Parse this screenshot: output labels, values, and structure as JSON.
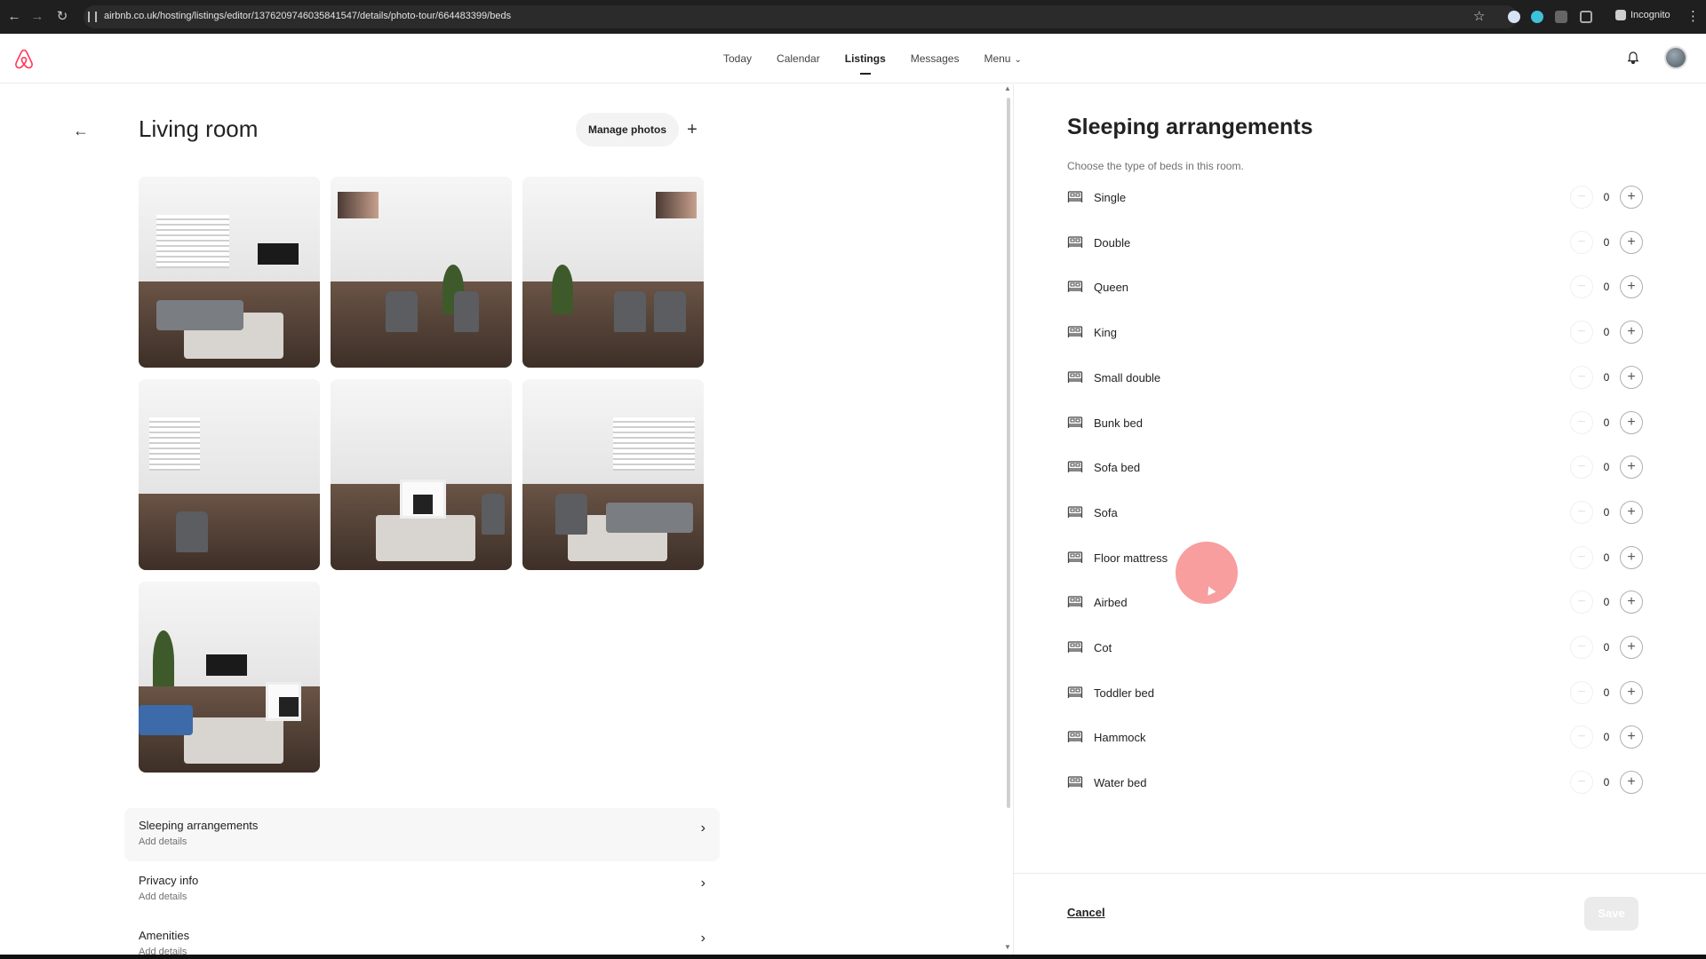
{
  "browser": {
    "url": "airbnb.co.uk/hosting/listings/editor/1376209746035841547/details/photo-tour/664483399/beds",
    "mode_label": "Incognito"
  },
  "nav": {
    "items": [
      {
        "label": "Today",
        "active": false
      },
      {
        "label": "Calendar",
        "active": false
      },
      {
        "label": "Listings",
        "active": true
      },
      {
        "label": "Messages",
        "active": false
      },
      {
        "label": "Menu",
        "active": false
      }
    ]
  },
  "room": {
    "title": "Living room",
    "manage_photos_label": "Manage photos",
    "add_label": "+",
    "photos": [
      {
        "scene": "sofa-tv"
      },
      {
        "scene": "chairs-plant"
      },
      {
        "scene": "dining-picture"
      },
      {
        "scene": "hallway-desk"
      },
      {
        "scene": "fireplace"
      },
      {
        "scene": "sofa-window"
      },
      {
        "scene": "tv-fireplace"
      }
    ],
    "sections": [
      {
        "title": "Sleeping arrangements",
        "subtitle": "Add details"
      },
      {
        "title": "Privacy info",
        "subtitle": "Add details"
      },
      {
        "title": "Amenities",
        "subtitle": "Add details"
      }
    ]
  },
  "sleeping": {
    "title": "Sleeping arrangements",
    "subtitle": "Choose the type of beds in this room.",
    "minus_label": "−",
    "plus_label": "+",
    "beds": [
      {
        "label": "Single",
        "count": "0"
      },
      {
        "label": "Double",
        "count": "0"
      },
      {
        "label": "Queen",
        "count": "0"
      },
      {
        "label": "King",
        "count": "0"
      },
      {
        "label": "Small double",
        "count": "0"
      },
      {
        "label": "Bunk bed",
        "count": "0"
      },
      {
        "label": "Sofa bed",
        "count": "0"
      },
      {
        "label": "Sofa",
        "count": "0"
      },
      {
        "label": "Floor mattress",
        "count": "0"
      },
      {
        "label": "Airbed",
        "count": "0"
      },
      {
        "label": "Cot",
        "count": "0"
      },
      {
        "label": "Toddler bed",
        "count": "0"
      },
      {
        "label": "Hammock",
        "count": "0"
      },
      {
        "label": "Water bed",
        "count": "0"
      }
    ],
    "cancel_label": "Cancel",
    "save_label": "Save"
  },
  "colors": {
    "brand": "#FF385C",
    "cursor_halo": "#F46262"
  }
}
